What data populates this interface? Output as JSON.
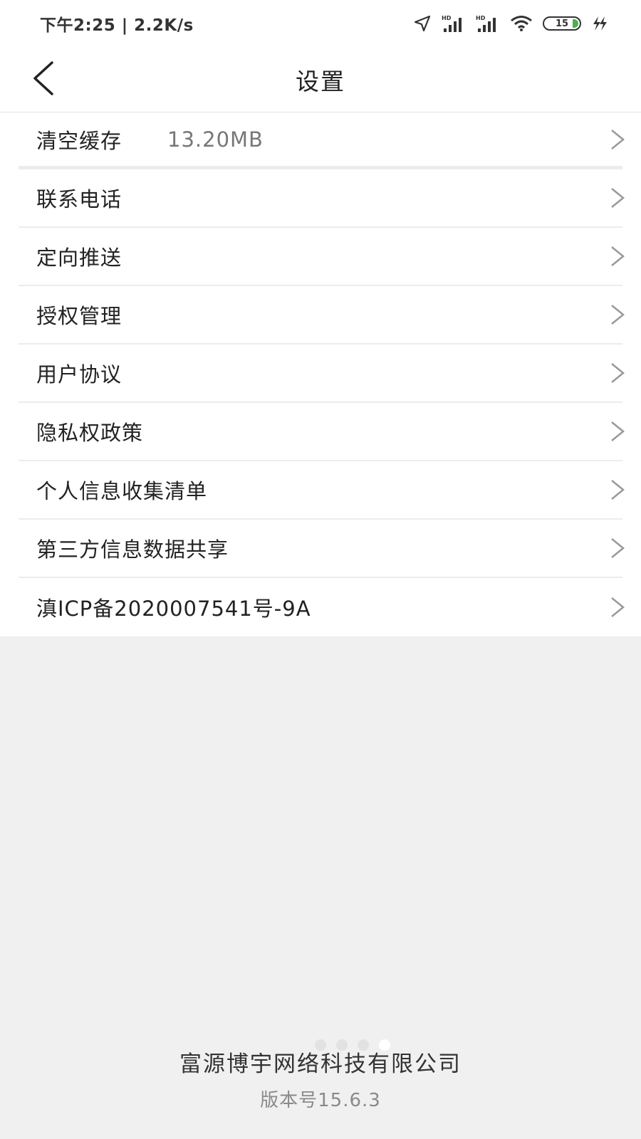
{
  "status_bar": {
    "time": "下午2:25 | 2.2K/s",
    "battery": "15",
    "icons": [
      "location-arrow-icon",
      "hd-signal-icon",
      "hd-signal-icon",
      "wifi-icon",
      "battery-icon",
      "charging-icon"
    ]
  },
  "header": {
    "back_icon": "chevron-left-icon",
    "title": "设置"
  },
  "settings": {
    "items": [
      {
        "label": "清空缓存",
        "value": "13.20MB"
      },
      {
        "label": "联系电话"
      },
      {
        "label": "定向推送"
      },
      {
        "label": "授权管理"
      },
      {
        "label": "用户协议"
      },
      {
        "label": "隐私权政策"
      },
      {
        "label": "个人信息收集清单"
      },
      {
        "label": "第三方信息数据共享"
      },
      {
        "label": "滇ICP备2020007541号-9A"
      }
    ]
  },
  "footer": {
    "company": "富源博宇网络科技有限公司",
    "version": "版本号15.6.3",
    "page_dots": 4,
    "active_dot": 4
  },
  "colors": {
    "background": "#f0f0f0",
    "surface": "#ffffff",
    "battery_green": "#4caf50",
    "chevron": "#999999"
  }
}
